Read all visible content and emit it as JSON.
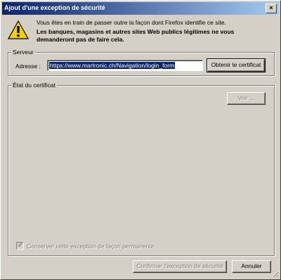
{
  "window": {
    "title": "Ajout d'une exception de sécurité",
    "close_glyph": "×"
  },
  "icons": {
    "warning": "warning-triangle-icon",
    "close": "close-icon",
    "checkmark": "checkmark-icon",
    "resize": "resize-grip-icon"
  },
  "message": {
    "line1": "Vous êtes en train de passer outre la façon dont Firefox identifie ce site.",
    "line2": "Les banques, magasins et autres sites Web publics légitimes ne vous demanderont pas de faire cela."
  },
  "server": {
    "group_label": "Serveur",
    "address_label": "Adresse :",
    "address_value": "https://www.martronic.ch/Navigation/login_form",
    "get_cert_label": "Obtenir le certificat"
  },
  "certificate": {
    "group_label": "État du certificat",
    "view_label": "Voir ..."
  },
  "permanent": {
    "label": "Conserver cette exception de façon permanente",
    "checked": true
  },
  "buttons": {
    "confirm_label": "Confirmer l'exception de sécurité",
    "cancel_label": "Annuler"
  },
  "colors": {
    "titlebar_start": "#0a246a",
    "titlebar_end": "#a6caf0",
    "warning_fill": "#f5d000"
  }
}
